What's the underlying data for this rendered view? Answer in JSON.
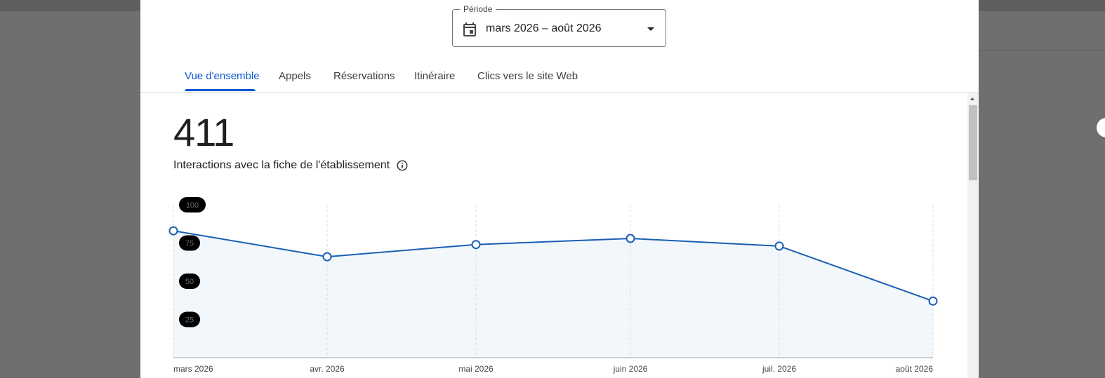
{
  "period": {
    "label": "Période",
    "value": "mars 2026 – août 2026"
  },
  "tabs": [
    {
      "label": "Vue d'ensemble",
      "active": true
    },
    {
      "label": "Appels",
      "active": false
    },
    {
      "label": "Réservations",
      "active": false
    },
    {
      "label": "Itinéraire",
      "active": false
    },
    {
      "label": "Clics vers le site Web",
      "active": false
    }
  ],
  "metric": {
    "value": "411",
    "label": "Interactions avec la fiche de l'établissement"
  },
  "icons": {
    "period": "calendar-icon",
    "dropdown": "caret-down-icon",
    "info": "info-icon"
  },
  "colors": {
    "accent": "#0b57d0",
    "line": "#1a5fb4",
    "area": "#f2f7fc"
  },
  "chart_data": {
    "type": "area",
    "categories": [
      "mars 2026",
      "avr. 2026",
      "mai 2026",
      "juin 2026",
      "juil. 2026",
      "août 2026"
    ],
    "values": [
      83,
      66,
      74,
      78,
      73,
      37
    ],
    "y_ticks": [
      "100",
      "75",
      "50",
      "25"
    ],
    "ylim": [
      0,
      100
    ],
    "grid": "vertical-dashed",
    "markers": "hollow-circles"
  }
}
